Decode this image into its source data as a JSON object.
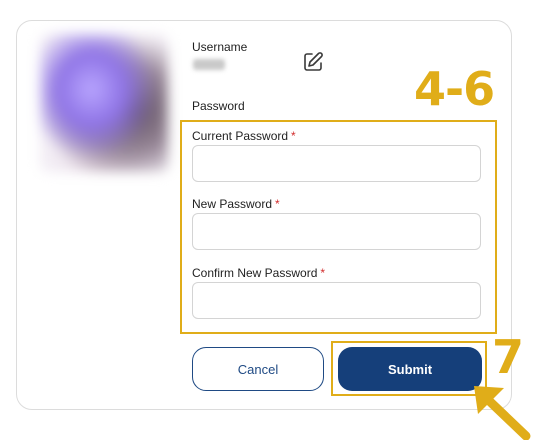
{
  "profile": {
    "username_label": "Username",
    "password_label": "Password"
  },
  "form": {
    "current_password": {
      "label": "Current Password",
      "required_mark": "*",
      "value": ""
    },
    "new_password": {
      "label": "New Password",
      "required_mark": "*",
      "value": ""
    },
    "confirm_password": {
      "label": "Confirm New Password",
      "required_mark": "*",
      "value": ""
    }
  },
  "buttons": {
    "cancel_label": "Cancel",
    "submit_label": "Submit"
  },
  "annotations": {
    "fields_step": "4-6",
    "submit_step": "7"
  },
  "colors": {
    "annotation": "#e0ad19",
    "primary": "#153f7a",
    "required": "#d22d2d"
  },
  "icons": {
    "edit": "edit-icon",
    "arrow": "arrow-pointer-icon"
  }
}
